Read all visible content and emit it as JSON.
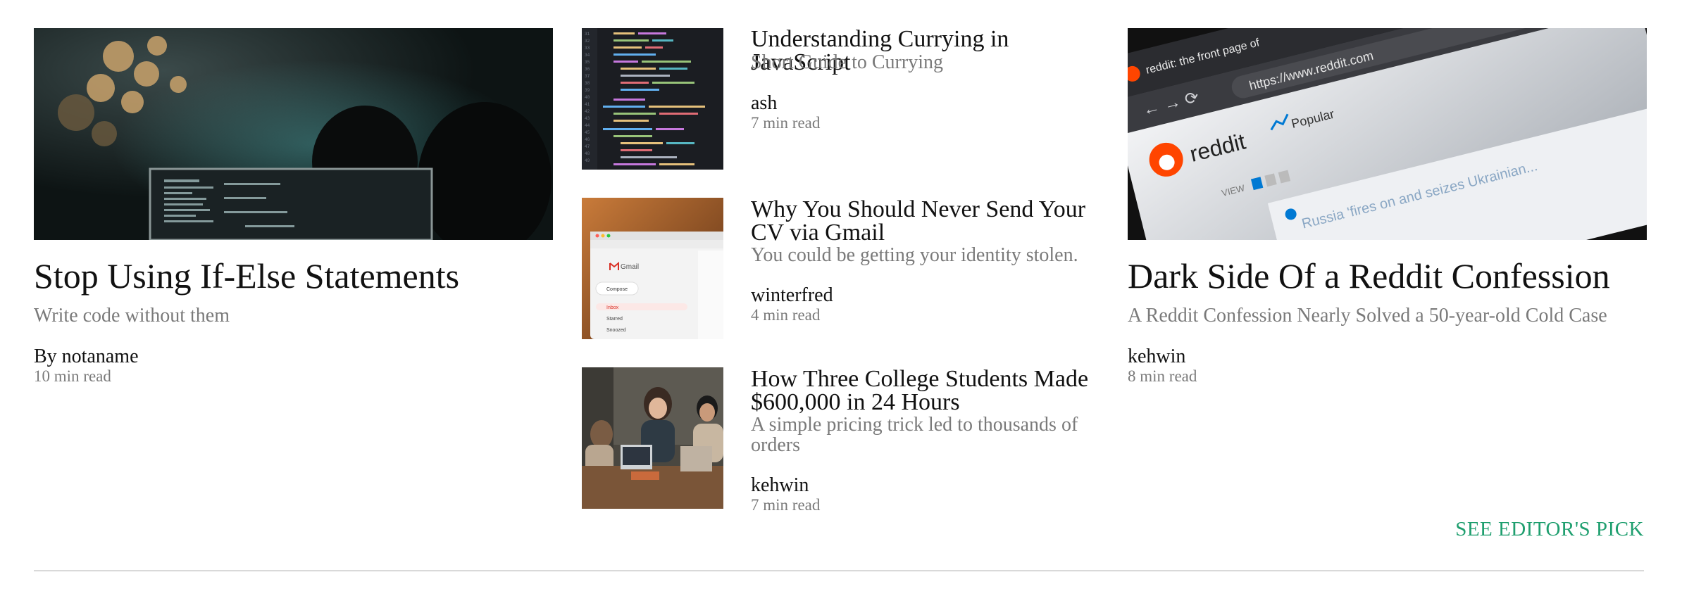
{
  "featured_left": {
    "image": "people-at-computer-with-code",
    "title": "Stop Using If-Else Statements",
    "subtitle": "Write code without them",
    "author": "By notaname",
    "read_time": "10 min read"
  },
  "list": [
    {
      "image": "code-editor-screenshot",
      "title": "Understanding Currying in JavaScript",
      "subtitle": "Short Guide to Currying",
      "author": "ash",
      "read_time": "7 min read"
    },
    {
      "image": "gmail-laptop",
      "title": "Why You Should Never Send Your CV via Gmail",
      "subtitle": "You could be getting your identity stolen.",
      "author": "winterfred",
      "read_time": "4 min read"
    },
    {
      "image": "students-at-table-with-laptops",
      "title": "How Three College Students Made $600,000 in 24 Hours",
      "subtitle": "A simple pricing trick led to thousands of orders",
      "author": "kehwin",
      "read_time": "7 min read"
    }
  ],
  "featured_right": {
    "image": "reddit-browser-screen",
    "title": "Dark Side Of a Reddit Confession",
    "subtitle": "A Reddit Confession Nearly Solved a 50-year-old Cold Case",
    "author": "kehwin",
    "read_time": "8 min read"
  },
  "image_text": {
    "gmail": "Gmail",
    "gmail_compose": "Compose",
    "gmail_inbox": "Inbox",
    "gmail_starred": "Starred",
    "gmail_snoozed": "Snoozed",
    "reddit_tab": "reddit: the front page of",
    "reddit_url": "https://www.reddit.com",
    "reddit_logo": "reddit",
    "reddit_popular": "Popular",
    "reddit_view": "VIEW",
    "reddit_post": "Russia 'fires on and seizes Ukrainian..."
  },
  "editors_pick_label": "SEE EDITOR'S PICK",
  "colors": {
    "accent": "#1f9f6f",
    "muted": "#7a7a7a"
  }
}
